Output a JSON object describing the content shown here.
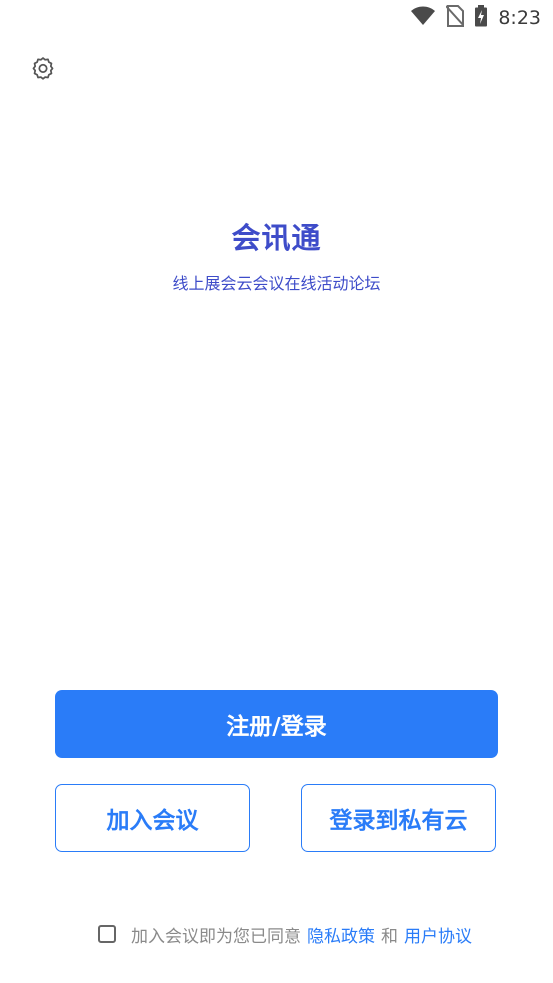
{
  "status_bar": {
    "time": "8:23",
    "icons": [
      "wifi-icon",
      "no-sim-icon",
      "battery-charging-icon"
    ]
  },
  "toolbar": {
    "settings_icon": "gear-icon"
  },
  "app": {
    "title": "会讯通",
    "subtitle": "线上展会云会议在线活动论坛"
  },
  "actions": {
    "register_login": "注册/登录",
    "join_meeting": "加入会议",
    "private_cloud_login": "登录到私有云"
  },
  "agreement": {
    "checked": false,
    "prefix": "加入会议即为您已同意",
    "privacy_policy": "隐私政策",
    "and": "和",
    "user_agreement": "用户协议"
  },
  "colors": {
    "primary": "#2a7cf8",
    "title": "#3e4cc9",
    "muted_text": "#8a8a8a"
  }
}
